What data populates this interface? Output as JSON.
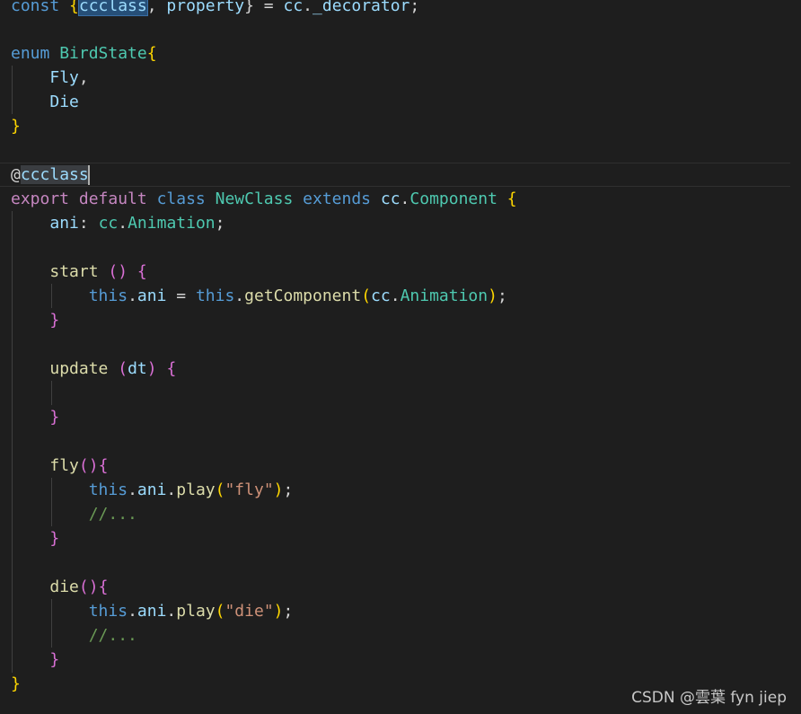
{
  "code": {
    "l1": {
      "kw": "const",
      "open": " {",
      "a": "ccclass",
      "sep": ", ",
      "b": "property",
      "close": "} = ",
      "obj": "cc",
      "dot": ".",
      "prop": "_decorator",
      "end": ";"
    },
    "l3": {
      "kw": "enum",
      "sp": " ",
      "name": "BirdState",
      "open": "{"
    },
    "l4": {
      "indent": "    ",
      "name": "Fly",
      "end": ","
    },
    "l5": {
      "indent": "    ",
      "name": "Die"
    },
    "l6": {
      "close": "}"
    },
    "l8": {
      "at": "@",
      "name": "ccclass"
    },
    "l9": {
      "k1": "export",
      "k2": "default",
      "k3": "class",
      "name": "NewClass",
      "k4": "extends",
      "obj": "cc",
      "dot": ".",
      "base": "Component",
      "open": " {"
    },
    "l10": {
      "indent": "    ",
      "field": "ani",
      "colon": ": ",
      "obj": "cc",
      "dot": ".",
      "type": "Animation",
      "end": ";"
    },
    "l12": {
      "indent": "    ",
      "fn": "start",
      "args": " () ",
      "open": "{"
    },
    "l13": {
      "indent": "        ",
      "this1": "this",
      "dot1": ".",
      "field": "ani",
      "eq": " = ",
      "this2": "this",
      "dot2": ".",
      "call": "getComponent",
      "po": "(",
      "obj": "cc",
      "dot3": ".",
      "type": "Animation",
      "pc": ")",
      "end": ";"
    },
    "l14": {
      "indent": "    ",
      "close": "}"
    },
    "l16": {
      "indent": "    ",
      "fn": "update",
      "po": " (",
      "arg": "dt",
      "pc": ") ",
      "open": "{"
    },
    "l18": {
      "indent": "    ",
      "close": "}"
    },
    "l20": {
      "indent": "    ",
      "fn": "fly",
      "parens": "()",
      "open": "{"
    },
    "l21": {
      "indent": "        ",
      "this": "this",
      "dot1": ".",
      "field": "ani",
      "dot2": ".",
      "call": "play",
      "po": "(",
      "str": "\"fly\"",
      "pc": ")",
      "end": ";"
    },
    "l22": {
      "indent": "        ",
      "comment": "//..."
    },
    "l23": {
      "indent": "    ",
      "close": "}"
    },
    "l25": {
      "indent": "    ",
      "fn": "die",
      "parens": "()",
      "open": "{"
    },
    "l26": {
      "indent": "        ",
      "this": "this",
      "dot1": ".",
      "field": "ani",
      "dot2": ".",
      "call": "play",
      "po": "(",
      "str": "\"die\"",
      "pc": ")",
      "end": ";"
    },
    "l27": {
      "indent": "        ",
      "comment": "//..."
    },
    "l28": {
      "indent": "    ",
      "close": "}"
    },
    "l29": {
      "close": "}"
    }
  },
  "watermark": "CSDN @雲葉 fyn jiep"
}
